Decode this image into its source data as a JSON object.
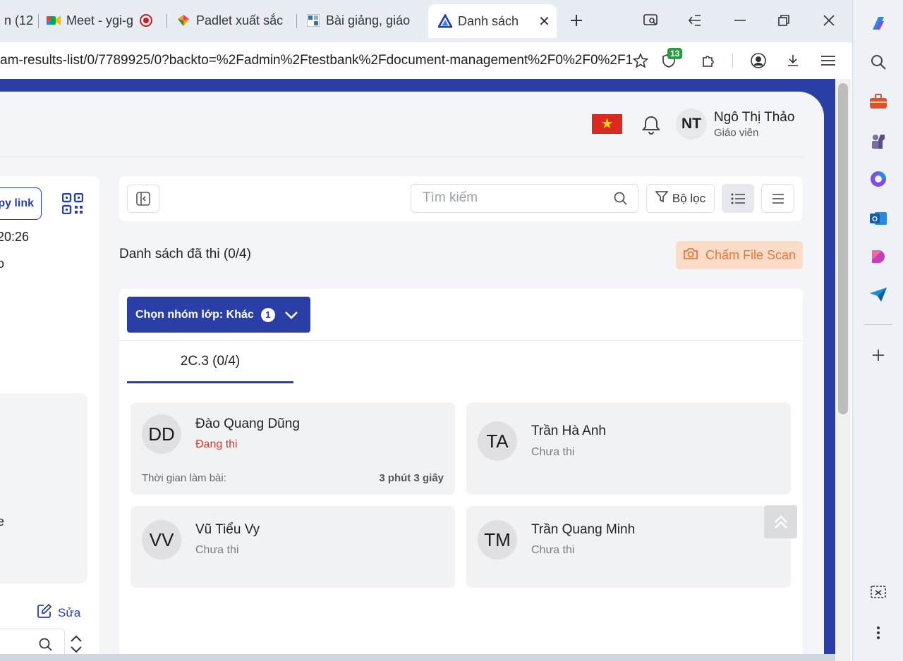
{
  "browser": {
    "tabs": [
      {
        "label": "n (12"
      },
      {
        "label": "Meet - ygi-g"
      },
      {
        "label": "Padlet xuất sắc"
      },
      {
        "label": "Bài giảng, giáo"
      },
      {
        "label": "Danh sách"
      }
    ],
    "url": "am-results-list/0/7789925/0?backto=%2Fadmin%2Ftestbank%2Fdocument-management%2F0%2F0%2F1",
    "extension_badge": "13"
  },
  "header": {
    "user_initials": "NT",
    "user_name": "Ngô Thị Thảo",
    "user_role": "Giáo viên"
  },
  "left_panel": {
    "copy_link_label": "py link",
    "time_fragment": "20:26",
    "text_fragment_1": "o",
    "text_fragment_2": "e",
    "edit_label": "Sửa"
  },
  "toolbar": {
    "search_placeholder": "Tìm kiếm",
    "filter_label": "Bộ lọc"
  },
  "list": {
    "title": "Danh sách đã thi (0/4)",
    "scan_button": "Chấm File Scan",
    "group_select_label": "Chọn nhóm lớp: Khác",
    "group_count": "1",
    "class_tab": "2C.3 (0/4)",
    "students": [
      {
        "initials": "DD",
        "name": "Đào Quang Dũng",
        "status": "Đang thi",
        "time_label": "Thời gian làm bài:",
        "time_value": "3 phút 3 giây"
      },
      {
        "initials": "TA",
        "name": "Trần Hà Anh",
        "status": "Chưa thi"
      },
      {
        "initials": "VV",
        "name": "Vũ Tiểu Vy",
        "status": "Chưa thi"
      },
      {
        "initials": "TM",
        "name": "Trần Quang Minh",
        "status": "Chưa thi"
      }
    ]
  },
  "colors": {
    "brand_blue": "#2a3fa6",
    "active_status": "#d33a2c",
    "scan_orange": "#e5783a"
  }
}
